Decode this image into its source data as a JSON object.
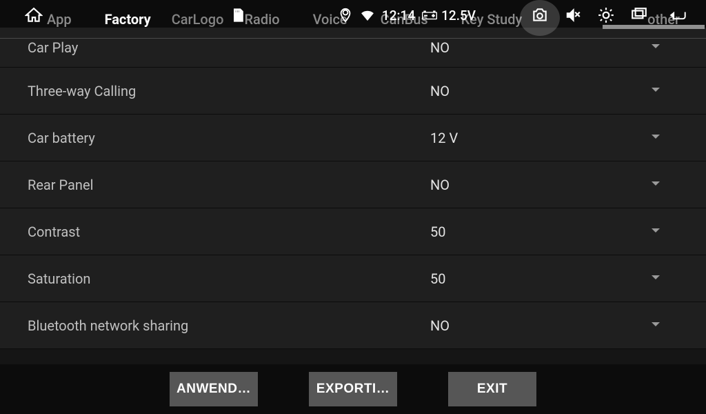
{
  "statusbar": {
    "time": "12:14",
    "voltage": "12.5V"
  },
  "tabs": {
    "items": [
      {
        "label": "App",
        "active": false
      },
      {
        "label": "Factory",
        "active": true
      },
      {
        "label": "Radio",
        "active": false
      },
      {
        "label": "Voice",
        "active": false
      },
      {
        "label": "CanBus",
        "active": false
      },
      {
        "label": "Key Study",
        "active": false
      },
      {
        "label": "other",
        "active": false
      }
    ],
    "hidden_mid": "CarLogo"
  },
  "settings": {
    "rows": [
      {
        "label": "Car Play",
        "value": "NO"
      },
      {
        "label": "Three-way Calling",
        "value": "NO"
      },
      {
        "label": "Car battery",
        "value": "12 V"
      },
      {
        "label": "Rear Panel",
        "value": "NO"
      },
      {
        "label": "Contrast",
        "value": "50"
      },
      {
        "label": "Saturation",
        "value": "50"
      },
      {
        "label": "Bluetooth network sharing",
        "value": "NO"
      }
    ]
  },
  "footer": {
    "apply": "ANWEND…",
    "export": "EXPORTI…",
    "exit": "EXIT"
  }
}
